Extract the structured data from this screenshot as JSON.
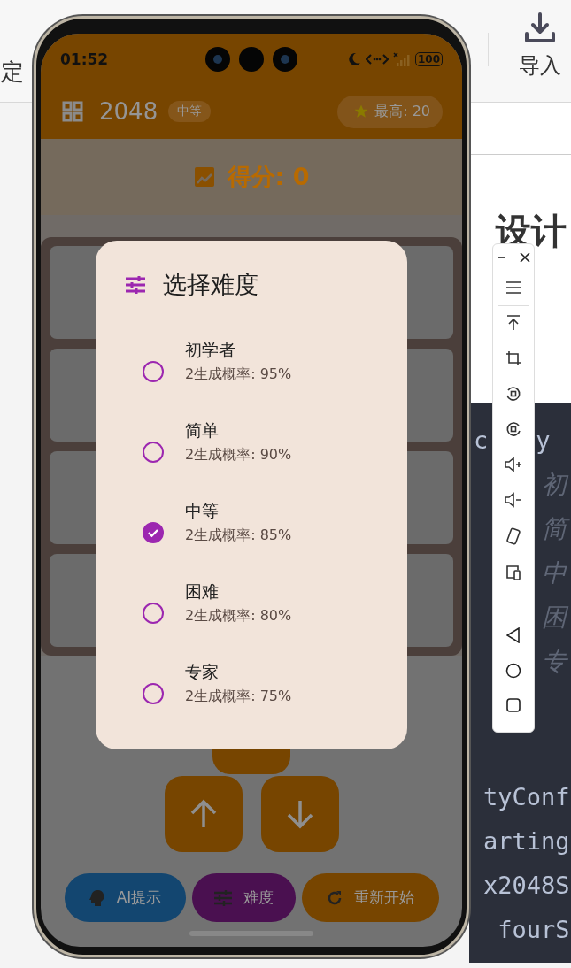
{
  "browser": {
    "left_fragment": "定",
    "import_button": "导入",
    "heading_fragment": "设计",
    "code_first_line": [
      "c",
      "y"
    ],
    "comment_glyphs": [
      "初",
      "简",
      "中",
      "困",
      "专"
    ],
    "code_lines": [
      "tyConf",
      "arting",
      "x2048S",
      " fourS"
    ]
  },
  "phone": {
    "status_bar": {
      "time": "01:52",
      "battery": "100"
    },
    "app_bar": {
      "title": "2048",
      "difficulty_badge": "中等",
      "best": "最高: 20"
    },
    "score": "得分: 0",
    "bottom_buttons": [
      {
        "kind": "hint",
        "label": "AI提示"
      },
      {
        "kind": "difficulty",
        "label": "难度"
      },
      {
        "kind": "restart",
        "label": "重新开始"
      }
    ]
  },
  "dialog": {
    "title": "选择难度",
    "options": [
      {
        "label": "初学者",
        "detail": "2生成概率: 95%",
        "selected": false
      },
      {
        "label": "简单",
        "detail": "2生成概率: 90%",
        "selected": false
      },
      {
        "label": "中等",
        "detail": "2生成概率: 85%",
        "selected": true
      },
      {
        "label": "困难",
        "detail": "2生成概率: 80%",
        "selected": false
      },
      {
        "label": "专家",
        "detail": "2生成概率: 75%",
        "selected": false
      }
    ]
  }
}
